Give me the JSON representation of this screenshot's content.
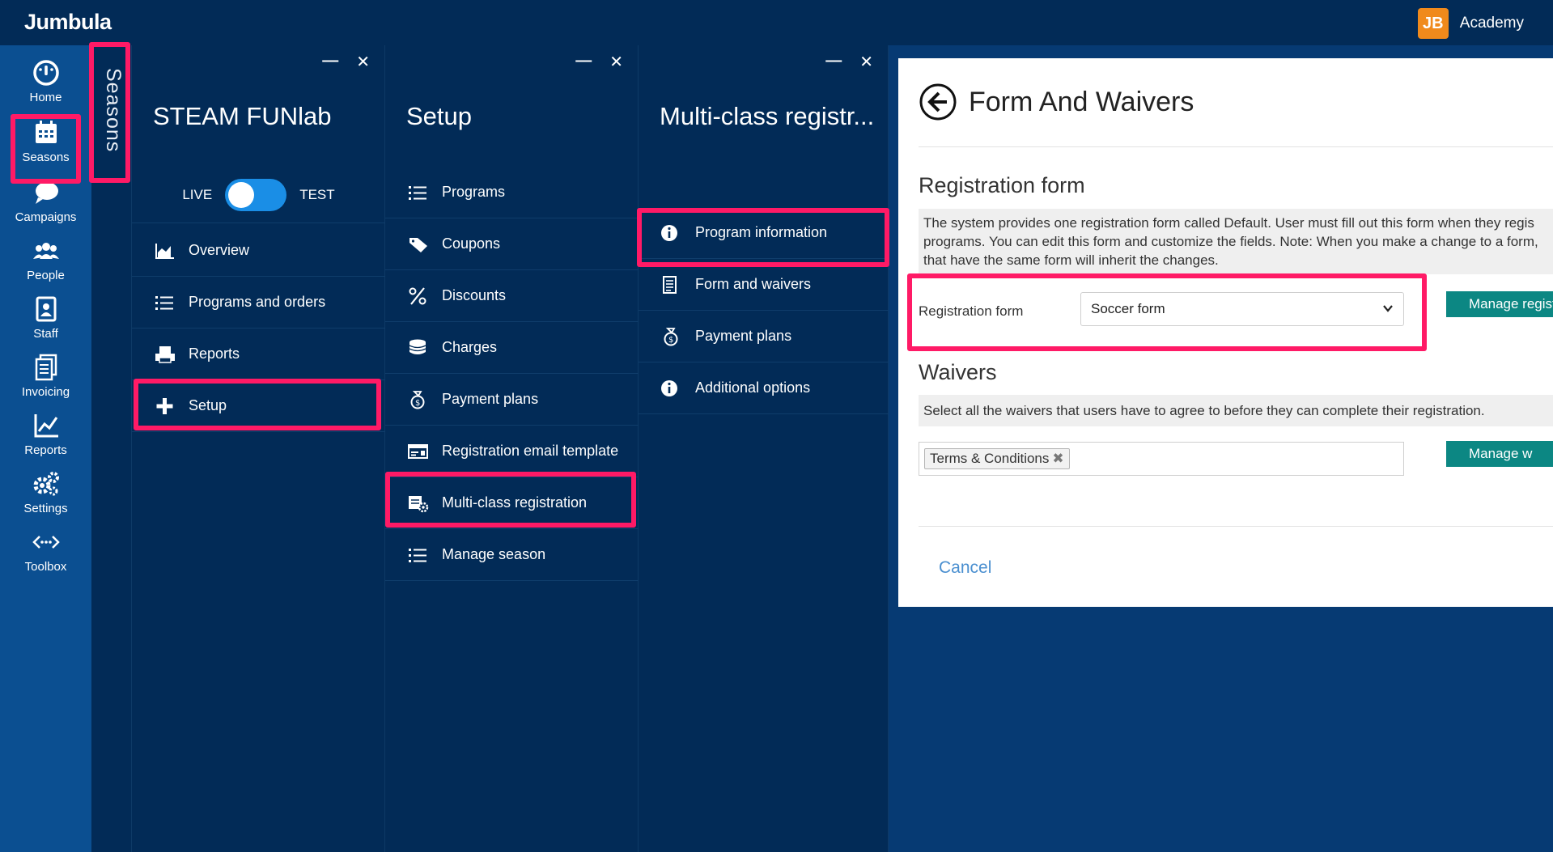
{
  "app": {
    "brand": "Jumbula",
    "academy_label": "Academy",
    "logo_text": "JB"
  },
  "colors": {
    "accent_highlight": "#ff1a66",
    "nav_bg": "#0b4f91",
    "panel_bg": "#022b57",
    "teal_button": "#0c8783",
    "toggle": "#1a8ee6"
  },
  "leftnav": {
    "items": [
      {
        "label": "Home",
        "icon": "home-gauge-icon"
      },
      {
        "label": "Seasons",
        "icon": "calendar-icon"
      },
      {
        "label": "Campaigns",
        "icon": "chat-bubbles-icon"
      },
      {
        "label": "People",
        "icon": "people-icon"
      },
      {
        "label": "Staff",
        "icon": "staff-badge-icon"
      },
      {
        "label": "Invoicing",
        "icon": "invoice-icon"
      },
      {
        "label": "Reports",
        "icon": "line-chart-icon"
      },
      {
        "label": "Settings",
        "icon": "gears-icon"
      },
      {
        "label": "Toolbox",
        "icon": "code-dots-icon"
      }
    ]
  },
  "seasons_strip": {
    "label": "Seasons"
  },
  "panel1": {
    "title": "STEAM FUNlab",
    "toggle": {
      "left": "LIVE",
      "right": "TEST"
    },
    "items": [
      {
        "label": "Overview",
        "icon": "area-chart-icon"
      },
      {
        "label": "Programs and orders",
        "icon": "list-icon"
      },
      {
        "label": "Reports",
        "icon": "printer-icon"
      },
      {
        "label": "Setup",
        "icon": "plus-icon"
      }
    ]
  },
  "panel2": {
    "title": "Setup",
    "items": [
      {
        "label": "Programs",
        "icon": "list-icon"
      },
      {
        "label": "Coupons",
        "icon": "tag-icon"
      },
      {
        "label": "Discounts",
        "icon": "percent-icon"
      },
      {
        "label": "Charges",
        "icon": "coins-icon"
      },
      {
        "label": "Payment plans",
        "icon": "money-bag-icon"
      },
      {
        "label": "Registration email template",
        "icon": "email-template-icon"
      },
      {
        "label": "Multi-class registration",
        "icon": "multi-class-icon"
      },
      {
        "label": "Manage season",
        "icon": "list-icon"
      }
    ]
  },
  "panel3": {
    "title": "Multi-class registr...",
    "items": [
      {
        "label": "Program information",
        "icon": "info-icon"
      },
      {
        "label": "Form and waivers",
        "icon": "document-icon"
      },
      {
        "label": "Payment plans",
        "icon": "money-bag-icon"
      },
      {
        "label": "Additional options",
        "icon": "info-icon"
      }
    ]
  },
  "content": {
    "title": "Form And Waivers",
    "registration_section": "Registration form",
    "registration_desc_1": "The system provides one registration form called Default. User must fill out this form when they regis",
    "registration_desc_2": "programs. You can edit this form and customize the fields. Note: When you make a change to a form,",
    "registration_desc_3": "that have the same form will inherit the changes.",
    "field_label": "Registration form",
    "select_value": "Soccer form",
    "manage_reg_button": "Manage regist",
    "waivers_section": "Waivers",
    "waivers_desc": "Select all the waivers that users have to agree to before they can complete their registration.",
    "waiver_tag": "Terms & Conditions",
    "manage_waivers_button": "Manage w",
    "cancel": "Cancel"
  }
}
